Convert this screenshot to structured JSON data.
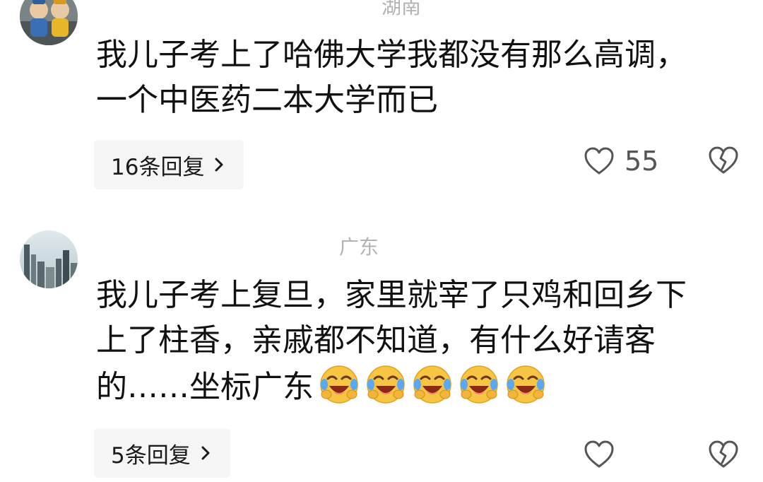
{
  "comments": [
    {
      "location": "湖南",
      "lines": [
        "我儿子考上了哈佛大学我都没有那么高调，",
        "一个中医药二本大学而已"
      ],
      "reply_label": "16条回复",
      "like_count": "55"
    },
    {
      "location": "广东",
      "lines": [
        "我儿子考上复旦，家里就宰了只鸡和回乡下",
        "上了柱香，亲戚都不知道，有什么好请客",
        "的……坐标广东"
      ],
      "emoji": "laughing-crying-emoji",
      "emoji_count": 5,
      "reply_label": "5条回复"
    }
  ],
  "icons": {
    "like": "heart-outline-icon",
    "dislike": "broken-heart-icon",
    "chevron": "chevron-right-icon"
  },
  "colors": {
    "location_text": "#b3b3b3",
    "reply_bg": "#f5f5f5",
    "icon_gray": "#555555"
  }
}
